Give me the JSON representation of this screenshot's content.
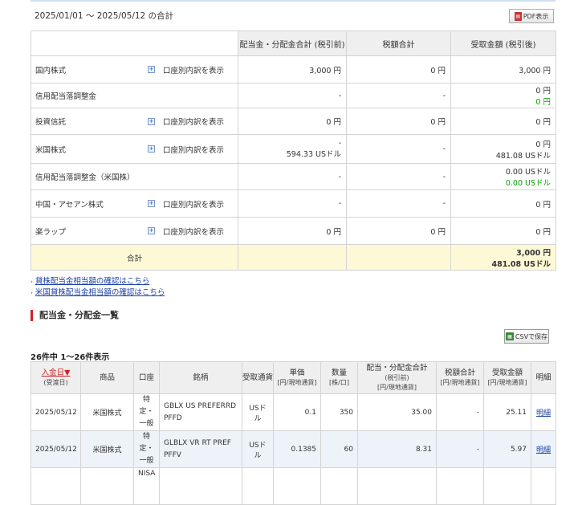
{
  "period": "2025/01/01 ～ 2025/05/12 の合計",
  "pdf_button": "PDF表示",
  "summary": {
    "headers": [
      "配当金・分配金合計 (税引前)",
      "税額合計",
      "受取金額 (税引後)"
    ],
    "detail_label": "口座別内訳を表示",
    "rows": [
      {
        "label": "国内株式",
        "pretax": [
          "3,000 円"
        ],
        "tax": [
          "0 円"
        ],
        "net": [
          "3,000 円"
        ]
      },
      {
        "label": "信用配当落調整金",
        "pretax": [
          "-"
        ],
        "tax": [
          "-"
        ],
        "net": [
          "0 円",
          "0 円"
        ]
      },
      {
        "label": "投資信託",
        "pretax": [
          "0 円"
        ],
        "tax": [
          "0 円"
        ],
        "net": [
          "0 円"
        ]
      },
      {
        "label": "米国株式",
        "pretax": [
          "-",
          "594.33 USドル"
        ],
        "tax": [
          "-"
        ],
        "net": [
          "0 円",
          "481.08 USドル"
        ]
      },
      {
        "label": "信用配当落調整金（米国株）",
        "pretax": [
          "-"
        ],
        "tax": [
          "-"
        ],
        "net": [
          "0.00 USドル",
          "0.00 USドル"
        ]
      },
      {
        "label": "中国・アセアン株式",
        "pretax": [
          "-"
        ],
        "tax": [
          "-"
        ],
        "net": [
          "0 円"
        ]
      },
      {
        "label": "楽ラップ",
        "pretax": [
          "0 円"
        ],
        "tax": [
          "0 円"
        ],
        "net": [
          "0 円"
        ]
      }
    ],
    "total_label": "合計",
    "total_net": [
      "3,000 円",
      "481.08 USドル"
    ]
  },
  "links": [
    "貸株配当金相当額の確認はこちら",
    "米国貸株配当金相当額の確認はこちら"
  ],
  "section_title": "配当金・分配金一覧",
  "csv_button": "CSVで保存",
  "count_text": "26件中 1～26件表示",
  "list": {
    "headers": {
      "date": "入金日▼",
      "date_sub": "(受渡日)",
      "product": "商品",
      "account": "口座",
      "name": "銘柄",
      "currency": "受取通貨",
      "unit": "単価",
      "unit_sub": "[円/現地通貨]",
      "qty": "数量",
      "qty_sub": "[株/口]",
      "pretax": "配当・分配金合計",
      "pretax_mid": "(税引前)",
      "pretax_sub": "[円/現地通貨]",
      "tax": "税額合計",
      "tax_sub": "[円/現地通貨]",
      "net": "受取金額",
      "net_sub": "[円/現地通貨]",
      "detail": "明細"
    },
    "rows": [
      {
        "date": "2025/05/12",
        "product": "米国株式",
        "account": [
          "特",
          "定・",
          "一般"
        ],
        "name": "GBLX US PREFERRD PFFD",
        "currency": "USドル",
        "unit": "0.1",
        "qty": "350",
        "pretax": "35.00",
        "tax": "-",
        "net": "25.11",
        "detail": "明細"
      },
      {
        "date": "2025/05/12",
        "product": "米国株式",
        "account": [
          "特",
          "定・",
          "一般"
        ],
        "name": "GLBLX VR RT PREF PFFV",
        "currency": "USドル",
        "unit": "0.1385",
        "qty": "60",
        "pretax": "8.31",
        "tax": "-",
        "net": "5.97",
        "detail": "明細"
      },
      {
        "date": "",
        "product": "",
        "account": [
          "NISA"
        ],
        "name": "",
        "currency": "",
        "unit": "",
        "qty": "",
        "pretax": "",
        "tax": "",
        "net": "",
        "detail": ""
      }
    ]
  }
}
